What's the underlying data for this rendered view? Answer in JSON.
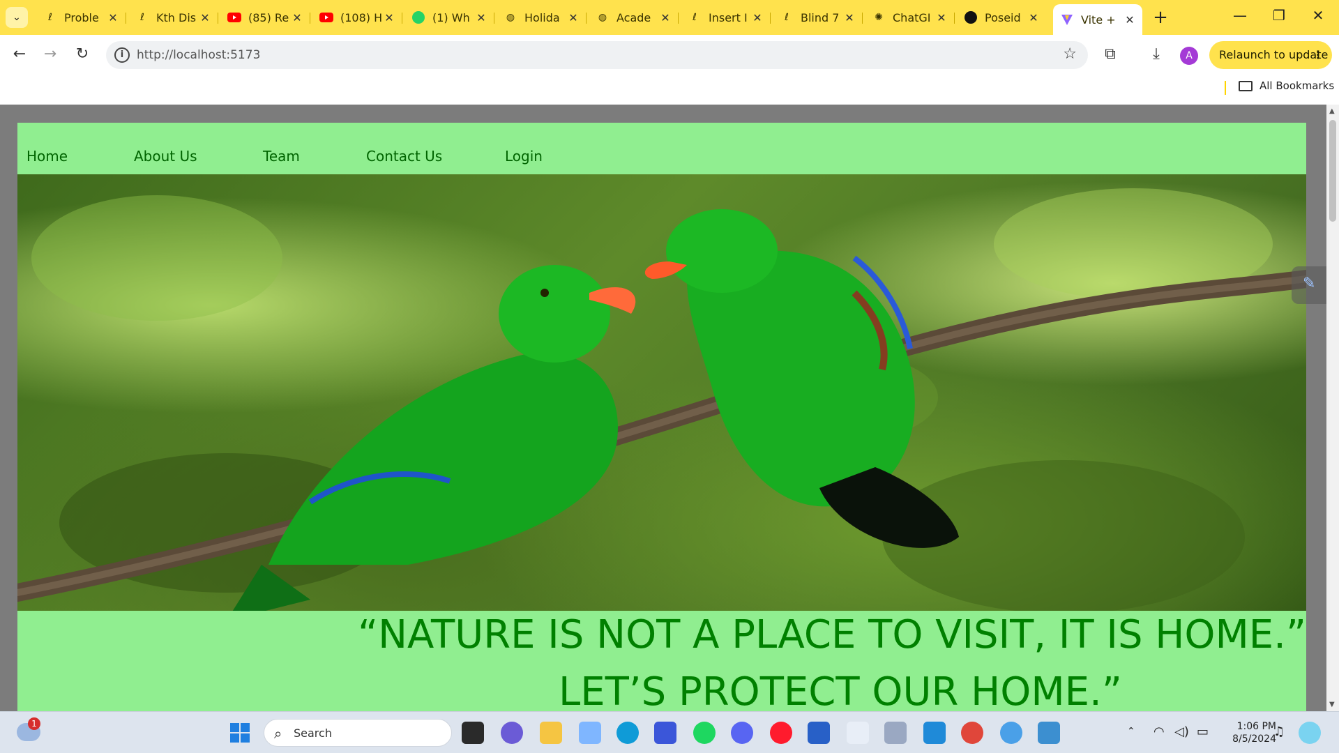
{
  "browser": {
    "tabs": [
      {
        "label": "Proble",
        "icon": "leetcode-icon"
      },
      {
        "label": "Kth Dis",
        "icon": "leetcode-icon"
      },
      {
        "label": "(85) Re",
        "icon": "youtube-icon"
      },
      {
        "label": "(108) H",
        "icon": "youtube-icon"
      },
      {
        "label": "(1) Wh",
        "icon": "whatsapp-icon"
      },
      {
        "label": "Holida",
        "icon": "globe-icon"
      },
      {
        "label": "Acade",
        "icon": "globe-icon"
      },
      {
        "label": "Insert I",
        "icon": "leetcode-icon"
      },
      {
        "label": "Blind 7",
        "icon": "leetcode-icon"
      },
      {
        "label": "ChatGI",
        "icon": "openai-icon"
      },
      {
        "label": "Poseid",
        "icon": "github-icon"
      },
      {
        "label": "Vite +",
        "icon": "vite-icon"
      }
    ],
    "url": "http://localhost:5173",
    "relaunch_label": "Relaunch to update",
    "profile_initial": "A",
    "all_bookmarks": "All Bookmarks"
  },
  "site": {
    "nav": {
      "home": "Home",
      "about": "About Us",
      "team": "Team",
      "contact": "Contact Us",
      "login": "Login"
    },
    "quote_line1": "“NATURE IS NOT A PLACE TO VISIT, IT IS HOME.”",
    "quote_line2": "LET’S PROTECT OUR HOME.”",
    "colors": {
      "nav_bg": "#90ee90",
      "nav_text": "#006400",
      "quote_text": "#008000"
    }
  },
  "taskbar": {
    "search_label": "Search",
    "notification_count": "1",
    "time": "1:06 PM",
    "date": "8/5/2024"
  }
}
